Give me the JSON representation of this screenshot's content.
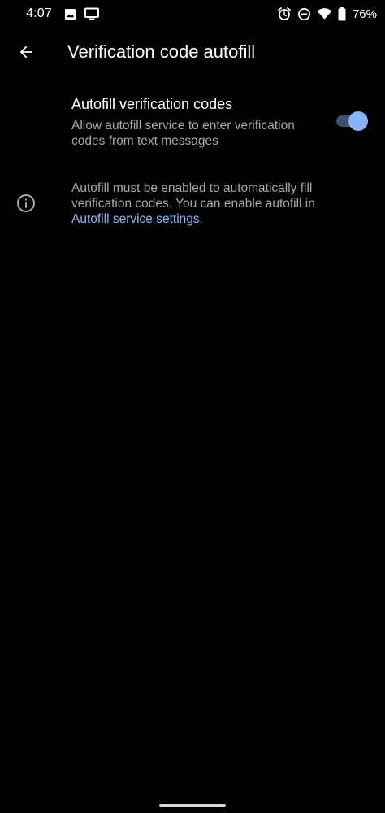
{
  "status_bar": {
    "time": "4:07",
    "battery_percent": "76%",
    "left_icons": [
      "image-icon",
      "cast-icon"
    ],
    "right_icons": [
      "alarm-icon",
      "do-not-disturb-icon",
      "wifi-icon",
      "battery-icon"
    ]
  },
  "app_bar": {
    "title": "Verification code autofill"
  },
  "setting": {
    "title": "Autofill verification codes",
    "summary": "Allow autofill service to enter verification codes from text messages",
    "toggle_on": true
  },
  "info": {
    "text": "Autofill must be enabled to automatically fill verification codes. You can enable autofill in ",
    "link_text": "Autofill service settings",
    "suffix": "."
  },
  "colors": {
    "background": "#000000",
    "accent": "#8ab4f8",
    "secondary_text": "#a8a8a8"
  }
}
